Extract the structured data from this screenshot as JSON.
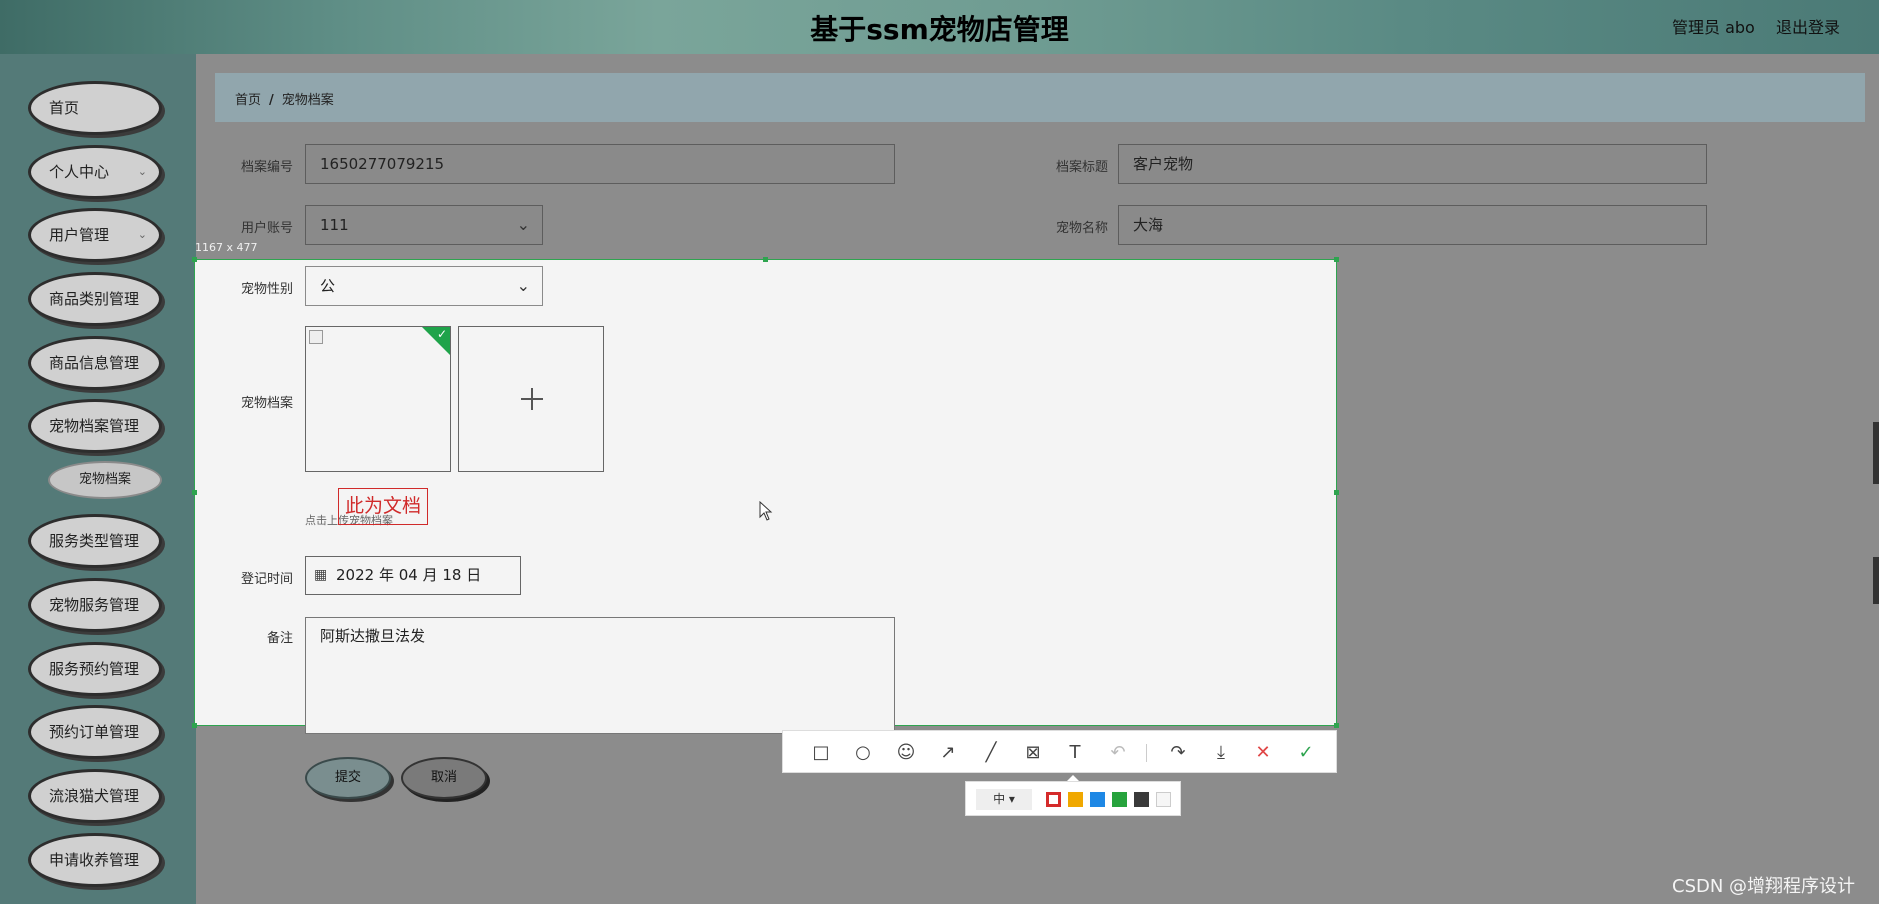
{
  "header": {
    "title": "基于ssm宠物店管理",
    "user": "管理员 abo",
    "logout": "退出登录"
  },
  "sidebar": {
    "items": [
      {
        "label": "首页"
      },
      {
        "label": "个人中心",
        "chevron": "⌄"
      },
      {
        "label": "用户管理",
        "chevron": "⌄"
      },
      {
        "label": "商品类别管理"
      },
      {
        "label": "商品信息管理"
      },
      {
        "label": "宠物档案管理"
      },
      {
        "label": "服务类型管理"
      },
      {
        "label": "宠物服务管理"
      },
      {
        "label": "服务预约管理"
      },
      {
        "label": "预约订单管理"
      },
      {
        "label": "流浪猫犬管理"
      },
      {
        "label": "申请收养管理"
      }
    ],
    "sub_item": "宠物档案"
  },
  "breadcrumb": {
    "home": "首页",
    "sep": "/",
    "current": "宠物档案"
  },
  "form": {
    "archive_no_label": "档案编号",
    "archive_no": "1650277079215",
    "archive_title_label": "档案标题",
    "archive_title": "客户宠物",
    "user_account_label": "用户账号",
    "user_account": "111",
    "pet_name_label": "宠物名称",
    "pet_name": "大海",
    "pet_gender_label": "宠物性别",
    "pet_gender": "公",
    "pet_archive_label": "宠物档案",
    "upload_hint": "点击上传宠物档案",
    "reg_time_label": "登记时间",
    "reg_time": "2022 年 04 月 18 日",
    "remark_label": "备注",
    "remark": "阿斯达撒旦法发",
    "submit": "提交",
    "cancel": "取消"
  },
  "capture": {
    "size_label": "1167 x 477",
    "annotation": "此为文档"
  },
  "toolbar": {
    "icons": [
      "rectangle-icon",
      "ellipse-icon",
      "emoji-icon",
      "arrow-icon",
      "line-icon",
      "mosaic-icon",
      "text-icon",
      "undo-icon",
      "share-icon",
      "download-icon",
      "cancel-icon",
      "confirm-icon"
    ],
    "pen_size": "中 ▾",
    "colors": [
      "#d52b2b",
      "#f0a800",
      "#1e88e5",
      "#27a33d",
      "#3a3a3a",
      "#f6f6f6"
    ]
  },
  "watermark": "CSDN @增翔程序设计"
}
